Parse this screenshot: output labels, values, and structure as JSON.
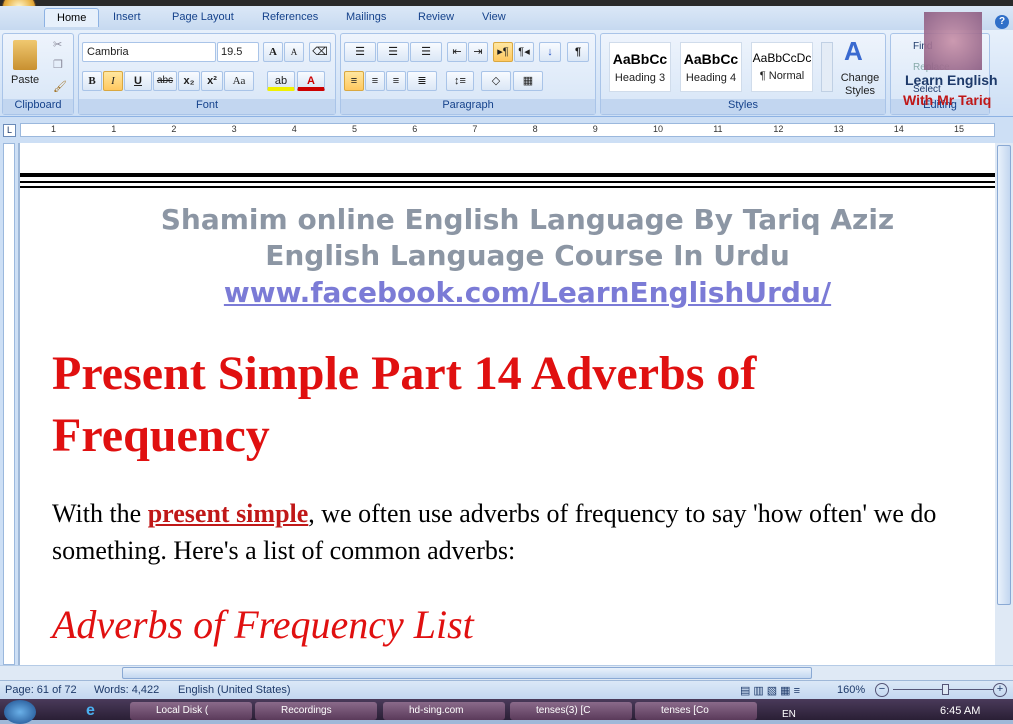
{
  "ribbon": {
    "tabs": [
      "Home",
      "Insert",
      "Page Layout",
      "References",
      "Mailings",
      "Review",
      "View"
    ],
    "clipboard": {
      "paste": "Paste",
      "label": "Clipboard"
    },
    "font": {
      "name": "Cambria",
      "size": "19.5",
      "label": "Font",
      "bold": "B",
      "italic": "I",
      "underline": "U",
      "strike": "abc",
      "sub": "x₂",
      "sup": "x²",
      "case": "Aa",
      "grow": "A",
      "shrink": "A"
    },
    "paragraph": {
      "label": "Paragraph"
    },
    "styles": {
      "label": "Styles",
      "items": [
        {
          "sample": "AaBbCc",
          "name": "Heading 3"
        },
        {
          "sample": "AaBbCc",
          "name": "Heading 4"
        },
        {
          "sample": "AaBbCcDc",
          "name": "¶ Normal"
        }
      ],
      "change": "Change Styles"
    },
    "editing": {
      "find": "Find",
      "replace": "Replace",
      "select": "Select",
      "label": "Editing"
    },
    "help": "?"
  },
  "watermark": {
    "line1": "Learn English",
    "line2": "With Mr Tariq"
  },
  "ruler": {
    "marks": [
      "2",
      "1",
      "1",
      "2",
      "3",
      "4",
      "5",
      "6",
      "7",
      "8",
      "9",
      "10",
      "11",
      "12",
      "13",
      "14",
      "15"
    ]
  },
  "document": {
    "header1": "Shamim online English Language By Tariq Aziz",
    "header2": "English Language Course In Urdu",
    "link": "www.facebook.com/LearnEnglishUrdu/",
    "title": "Present Simple Part 14 Adverbs of Frequency",
    "para_before": "With the ",
    "para_link": "present simple",
    "para_after": ", we often use adverbs of frequency to say 'how often' we do",
    "para_line2": "something. Here's a list of common adverbs:",
    "subtitle": "Adverbs of Frequency List"
  },
  "status": {
    "page": "Page: 61 of 72",
    "words": "Words: 4,422",
    "language": "English (United States)",
    "zoom": "160%"
  },
  "taskbar": {
    "items": [
      "Local Disk (",
      "Recordings",
      "hd-sing.com",
      "tenses(3) [C",
      "tenses [Co"
    ],
    "lang": "EN",
    "time": "6:45 AM"
  }
}
